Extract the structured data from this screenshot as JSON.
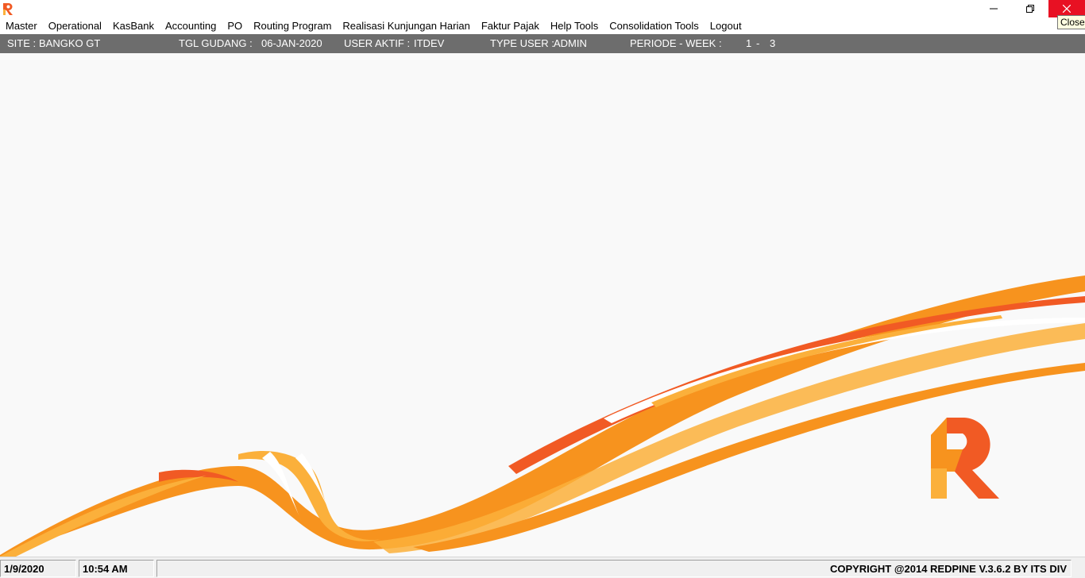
{
  "window": {
    "app_icon": "redpine-r-icon",
    "minimize_icon": "minimize-icon",
    "maximize_icon": "restore-icon",
    "close_icon": "close-icon",
    "tooltip": "Close"
  },
  "menu": [
    {
      "label": "Master"
    },
    {
      "label": "Operational"
    },
    {
      "label": "KasBank"
    },
    {
      "label": "Accounting"
    },
    {
      "label": "PO"
    },
    {
      "label": "Routing Program"
    },
    {
      "label": "Realisasi Kunjungan Harian"
    },
    {
      "label": "Faktur Pajak"
    },
    {
      "label": "Help Tools"
    },
    {
      "label": "Consolidation Tools"
    },
    {
      "label": "Logout"
    }
  ],
  "info": {
    "site_label": "SITE :",
    "site_value": "BANGKO GT",
    "tgl_label": "TGL GUDANG :",
    "tgl_value": "06-JAN-2020",
    "user_label": "USER AKTIF :",
    "user_value": "ITDEV",
    "type_label": "TYPE USER :",
    "type_value": "ADMIN",
    "periode_label": "PERIODE - WEEK :",
    "periode_value": "1",
    "periode_sep": "-",
    "week_value": "3"
  },
  "status": {
    "date": "1/9/2020",
    "time": "10:54 AM",
    "copyright": "COPYRIGHT @2014 REDPINE V.3.6.2 BY ITS DIV"
  },
  "colors": {
    "infobar_bg": "#6d6d6d",
    "close_bg": "#e81123",
    "orange": "#f7931e",
    "orange_dark": "#f15a24",
    "yellow": "#fbb03b"
  }
}
